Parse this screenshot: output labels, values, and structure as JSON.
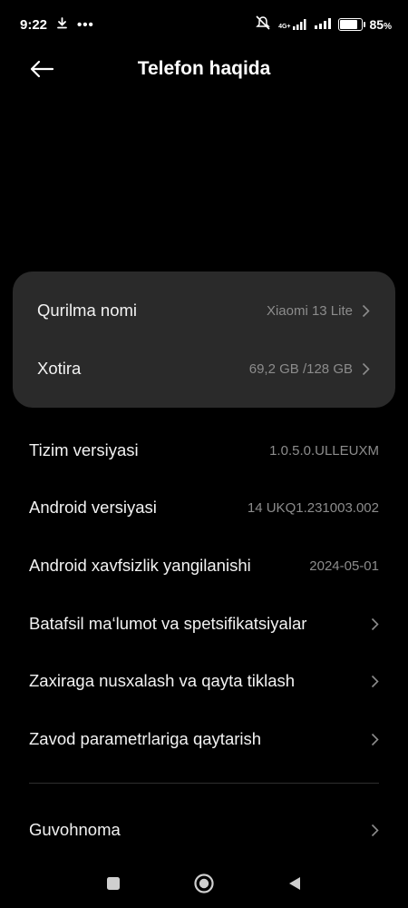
{
  "status_bar": {
    "time": "9:22",
    "dots": "•••",
    "network_label": "4G+",
    "battery_text": "85",
    "battery_unit": "%",
    "battery_level": 0.85,
    "icons": [
      "download-icon",
      "mute-icon",
      "signal-icon",
      "battery-icon"
    ]
  },
  "header": {
    "title": "Telefon haqida",
    "back_icon": "arrow-left-icon"
  },
  "card": {
    "items": [
      {
        "label": "Qurilma nomi",
        "value": "Xiaomi 13 Lite"
      },
      {
        "label": "Xotira",
        "value": "69,2 GB /128 GB"
      }
    ]
  },
  "list": {
    "items": [
      {
        "label": "Tizim versiyasi",
        "value": "1.0.5.0.ULLEUXM"
      },
      {
        "label": "Android versiyasi",
        "value": "14 UKQ1.231003.002"
      },
      {
        "label": "Android xavfsizlik yangilanishi",
        "value": "2024-05-01"
      },
      {
        "label": "Batafsil ma‘lumot va spetsifikatsiyalar",
        "value": ""
      },
      {
        "label": "Zaxiraga nusxalash va qayta tiklash",
        "value": ""
      },
      {
        "label": "Zavod parametrlariga qaytarish",
        "value": ""
      },
      {
        "label": "Guvohnoma",
        "value": ""
      }
    ]
  },
  "nav_bar": {
    "icons": [
      "recents-square-icon",
      "home-circle-icon",
      "back-triangle-icon"
    ]
  },
  "colors": {
    "background": "#000000",
    "card": "#2a2a2a",
    "secondary_text": "#8c8c8c",
    "primary_text": "#f2f2f2"
  }
}
